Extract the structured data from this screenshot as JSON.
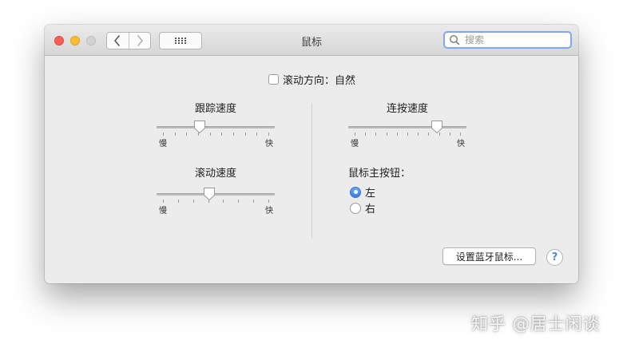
{
  "window": {
    "title": "鼠标"
  },
  "toolbar": {
    "back_icon": "chevron-left-icon",
    "forward_icon": "chevron-right-icon",
    "grid_icon": "show-all-grid-icon",
    "search_placeholder": "搜索",
    "search_value": ""
  },
  "scroll_direction": {
    "label": "滚动方向：自然",
    "checked": false
  },
  "tracking_speed": {
    "label": "跟踪速度",
    "min_label": "慢",
    "max_label": "快",
    "value_fraction": 0.35,
    "ticks": 10
  },
  "scrolling_speed": {
    "label": "滚动速度",
    "min_label": "慢",
    "max_label": "快",
    "value_fraction": 0.44,
    "ticks": 8
  },
  "double_click_speed": {
    "label": "连按速度",
    "min_label": "慢",
    "max_label": "快",
    "value_fraction": 0.78,
    "ticks": 11
  },
  "primary_button": {
    "label": "鼠标主按钮：",
    "options": [
      {
        "label": "左",
        "selected": true
      },
      {
        "label": "右",
        "selected": false
      }
    ]
  },
  "setup_button_label": "设置蓝牙鼠标...",
  "help_label": "?",
  "watermark": "知乎 @居士闲谈",
  "colors": {
    "accent": "#3b7ee6",
    "close": "#fd5f57",
    "minimize": "#febc2e",
    "window_bg": "#ececec"
  }
}
